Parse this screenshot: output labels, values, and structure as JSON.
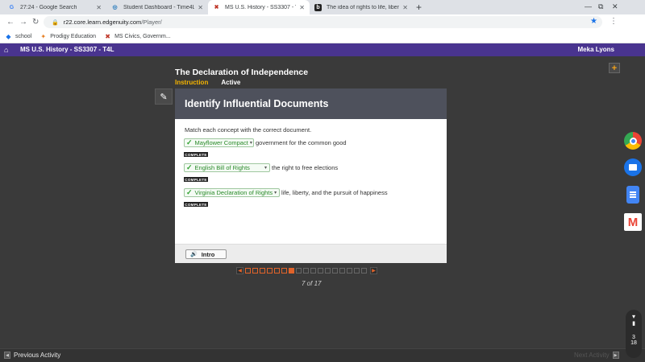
{
  "browser": {
    "tabs": [
      {
        "title": "27:24 - Google Search",
        "icon": "google-icon",
        "active": false
      },
      {
        "title": "Student Dashboard - Time4Learn",
        "icon": "edgenuity-icon",
        "active": false
      },
      {
        "title": "MS U.S. History - SS3307 - T4L -",
        "icon": "edgenuity-x-icon",
        "active": true
      },
      {
        "title": "The idea of rights to life, liberty a",
        "icon": "brainly-icon",
        "active": false
      }
    ],
    "url_host": "r22.core.learn.edgenuity.com",
    "url_path": "/Player/",
    "bookmarks": [
      {
        "label": "school",
        "icon": "school-icon"
      },
      {
        "label": "Prodigy Education",
        "icon": "prodigy-icon"
      },
      {
        "label": "MS Civics, Governm...",
        "icon": "edgenuity-x-icon"
      }
    ]
  },
  "header": {
    "course": "MS U.S. History - SS3307 - T4L",
    "user": "Meka Lyons"
  },
  "lesson": {
    "title": "The Declaration of Independence",
    "tab_instruction": "Instruction",
    "tab_status": "Active"
  },
  "activity": {
    "heading": "Identify Influential Documents",
    "instructions": "Match each concept with the correct document.",
    "rows": [
      {
        "selected": "Mayflower Compact",
        "concept": "government for the common good",
        "status": "COMPLETE"
      },
      {
        "selected": "English Bill of Rights",
        "concept": "the right to free elections",
        "status": "COMPLETE"
      },
      {
        "selected": "Virginia Declaration of Rights",
        "concept": "life, liberty, and the pursuit of happiness",
        "status": "COMPLETE"
      }
    ],
    "intro_button": "Intro"
  },
  "pager": {
    "current": 7,
    "total": 17,
    "label": "7 of 17"
  },
  "footer": {
    "prev_label": "Previous Activity",
    "next_label": "Next Activity"
  },
  "shelf": {
    "apps": [
      "chrome-icon",
      "files-icon",
      "docs-icon",
      "gmail-icon"
    ],
    "status_top": "3",
    "status_bottom": "18"
  },
  "colors": {
    "edgenuity_purple": "#49348f",
    "accent_orange": "#e0632a",
    "complete_green": "#2a8a2a"
  }
}
